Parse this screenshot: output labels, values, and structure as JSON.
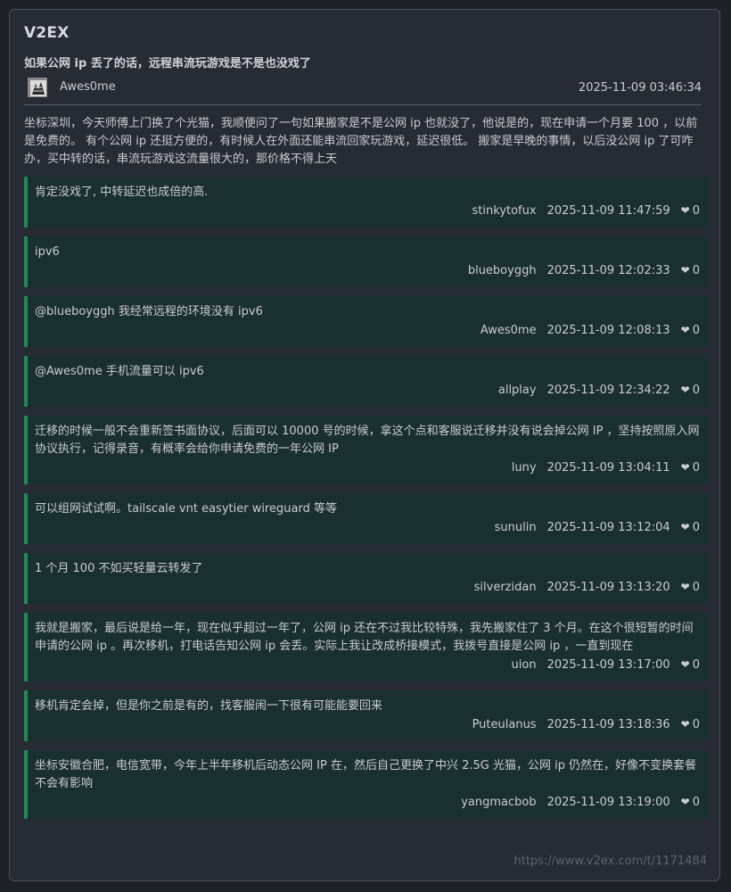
{
  "site": {
    "name": "V2EX"
  },
  "topic": {
    "title": "如果公网 ip 丢了的话，远程串流玩游戏是不是也没戏了",
    "author": "Awes0me",
    "time": "2025-11-09 03:46:34",
    "content": "坐标深圳，今天师傅上门换了个光猫，我顺便问了一句如果搬家是不是公网 ip 也就没了，他说是的，现在申请一个月要 100 ，以前是免费的。 有个公网 ip 还挺方便的，有时候人在外面还能串流回家玩游戏，延迟很低。 搬家是早晚的事情，以后没公网 ip 了可咋办，买中转的话，串流玩游戏这流量很大的，那价格不得上天"
  },
  "replies": [
    {
      "text": "肯定没戏了, 中转延迟也成倍的高.",
      "user": "stinkytofux",
      "time": "2025-11-09 11:47:59",
      "likes": "0"
    },
    {
      "text": "ipv6",
      "user": "blueboyggh",
      "time": "2025-11-09 12:02:33",
      "likes": "0"
    },
    {
      "text": "@blueboyggh 我经常远程的环境没有 ipv6",
      "user": "Awes0me",
      "time": "2025-11-09 12:08:13",
      "likes": "0"
    },
    {
      "text": "@Awes0me 手机流量可以 ipv6",
      "user": "allplay",
      "time": "2025-11-09 12:34:22",
      "likes": "0"
    },
    {
      "text": "迁移的时候一般不会重新签书面协议，后面可以 10000 号的时候，拿这个点和客服说迁移并没有说会掉公网 IP ，坚持按照原入网协议执行，记得录音，有概率会给你申请免费的一年公网 IP",
      "user": "luny",
      "time": "2025-11-09 13:04:11",
      "likes": "0"
    },
    {
      "text": "可以组网试试啊。tailscale vnt easytier wireguard 等等",
      "user": "sunulin",
      "time": "2025-11-09 13:12:04",
      "likes": "0"
    },
    {
      "text": "1 个月 100 不如买轻量云转发了",
      "user": "silverzidan",
      "time": "2025-11-09 13:13:20",
      "likes": "0"
    },
    {
      "text": "我就是搬家，最后说是给一年，现在似乎超过一年了，公网 ip 还在不过我比较特殊，我先搬家住了 3 个月。在这个很短暂的时间申请的公网 ip 。再次移机，打电话告知公网 ip 会丢。实际上我让改成桥接模式，我拨号直接是公网 ip ，一直到现在",
      "user": "uion",
      "time": "2025-11-09 13:17:00",
      "likes": "0"
    },
    {
      "text": "移机肯定会掉，但是你之前是有的，找客服闹一下很有可能能要回来",
      "user": "Puteulanus",
      "time": "2025-11-09 13:18:36",
      "likes": "0"
    },
    {
      "text": "坐标安徽合肥，电信宽带，今年上半年移机后动态公网 IP 在，然后自己更换了中兴 2.5G 光猫，公网 ip 仍然在，好像不变换套餐不会有影响",
      "user": "yangmacbob",
      "time": "2025-11-09 13:19:00",
      "likes": "0"
    }
  ],
  "footer": {
    "url": "https://www.v2ex.com/t/1171484"
  },
  "colors": {
    "accent": "#1f8a52",
    "reply_bg": "#1a2f2f",
    "card_bg": "#272b33"
  },
  "icons": {
    "like": "heart-icon"
  }
}
